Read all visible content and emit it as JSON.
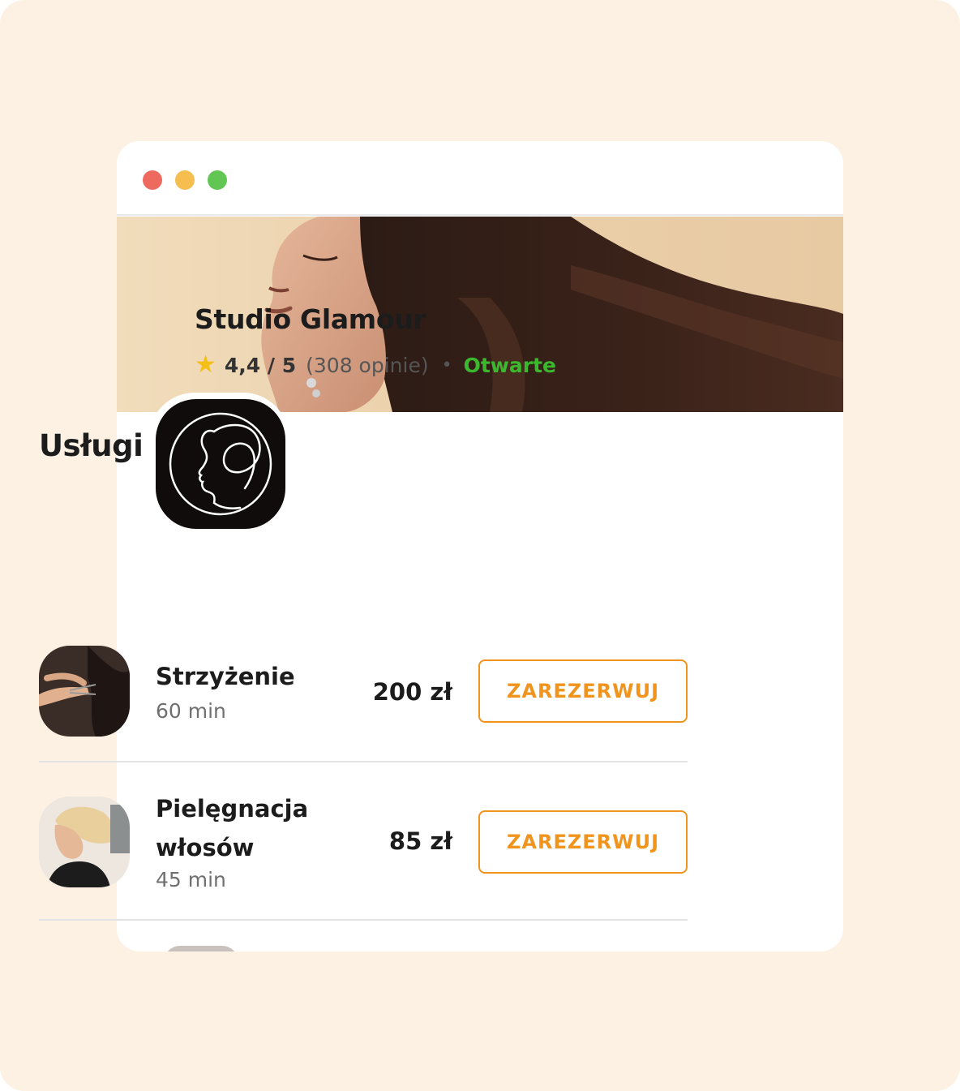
{
  "window": {
    "controls": [
      "close-dot",
      "minimize-dot",
      "maximize-dot"
    ]
  },
  "business": {
    "name": "Studio Glamour",
    "rating": "4,4 / 5",
    "reviews": "(308 opinie)",
    "separator": "•",
    "status": "Otwarte",
    "star_icon": "★"
  },
  "colors": {
    "accent": "#f0941e",
    "status_open": "#3cb82f",
    "star": "#f4bf16",
    "background": "#fcf1e2"
  },
  "services_section": {
    "title": "Usługi",
    "items": [
      {
        "name": "Strzyżenie",
        "duration": "60 min",
        "price": "200 zł",
        "button": "ZAREZERWUJ",
        "icon": "haircut-photo"
      },
      {
        "name": "Pielęgnacja włosów",
        "duration": "45 min",
        "price": "85 zł",
        "button": "ZAREZERWUJ",
        "icon": "hair-care-photo"
      }
    ]
  }
}
